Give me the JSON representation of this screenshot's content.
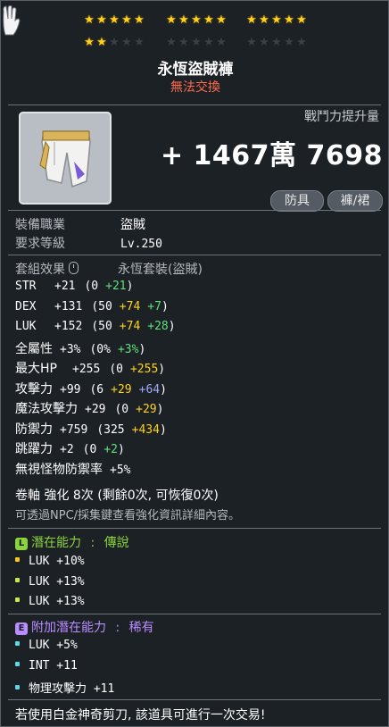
{
  "stars": {
    "groups": [
      {
        "filled": 5,
        "total": 5
      },
      {
        "filled": 5,
        "total": 5
      },
      {
        "filled": 5,
        "total": 5
      },
      {
        "filled": 2,
        "total": 5
      },
      {
        "filled": 0,
        "total": 5
      },
      {
        "filled": 0,
        "total": 5
      }
    ],
    "glyph": "★"
  },
  "item": {
    "name": "永恆盜賊褲",
    "trade_status": "無法交換",
    "combat_power_label": "戰鬥力提升量",
    "combat_power_value": "+ 1467萬 7698",
    "tags": [
      "防具",
      "褲/裙"
    ]
  },
  "requirements": {
    "job_label": "裝備職業",
    "job_value": "盜賊",
    "level_label": "要求等級",
    "level_value": "Lv.250"
  },
  "set": {
    "label": "套組效果",
    "value": "永恆套裝(盜賊)"
  },
  "stats": [
    {
      "name": "STR",
      "total": "+21",
      "base": "(0",
      "parts": [
        {
          "text": "+21",
          "color": "grn"
        }
      ],
      "close": ")"
    },
    {
      "name": "DEX",
      "total": "+131",
      "base": "(50",
      "parts": [
        {
          "text": "+74",
          "color": "yel"
        },
        {
          "text": "+7",
          "color": "grn"
        }
      ],
      "close": ")"
    },
    {
      "name": "LUK",
      "total": "+152",
      "base": "(50",
      "parts": [
        {
          "text": "+74",
          "color": "yel"
        },
        {
          "text": "+28",
          "color": "grn"
        }
      ],
      "close": ")"
    },
    {
      "name": "全屬性",
      "total": "+3%",
      "base": "(0%",
      "parts": [
        {
          "text": "+3%",
          "color": "grn"
        }
      ],
      "close": ")"
    },
    {
      "name": "最大HP",
      "total": "+255",
      "base": "(0",
      "parts": [
        {
          "text": "+255",
          "color": "yel"
        }
      ],
      "close": ")"
    },
    {
      "name": "攻擊力",
      "total": "+99",
      "base": "(6",
      "parts": [
        {
          "text": "+29",
          "color": "yel"
        },
        {
          "text": "+64",
          "color": "blu"
        }
      ],
      "close": ")"
    },
    {
      "name": "魔法攻擊力",
      "total": "+29",
      "base": "(0",
      "parts": [
        {
          "text": "+29",
          "color": "yel"
        }
      ],
      "close": ")"
    },
    {
      "name": "防禦力",
      "total": "+759",
      "base": "(325",
      "parts": [
        {
          "text": "+434",
          "color": "yel"
        }
      ],
      "close": ")"
    },
    {
      "name": "跳躍力",
      "total": "+2",
      "base": "(0",
      "parts": [
        {
          "text": "+2",
          "color": "grn"
        }
      ],
      "close": ")"
    },
    {
      "name": "無視怪物防禦率",
      "total": "+5%",
      "base": "",
      "parts": [],
      "close": ""
    }
  ],
  "upgrade": {
    "scroll_line": "卷軸 強化 8次 (剩餘0次, 可恢復0次)",
    "hint": "可透過NPC/採集鍵查看強化資訊詳細內容。"
  },
  "potential": {
    "badge": "L",
    "label": "潛在能力",
    "separator": ":",
    "grade": "傳說",
    "color": "#8bd33c",
    "lines": [
      "LUK +10%",
      "LUK +13%",
      "LUK +13%"
    ],
    "bullet_colors": [
      "#ffc21a",
      "#c8e84a",
      "#c8e84a"
    ]
  },
  "additional": {
    "badge": "E",
    "label": "附加潛在能力",
    "separator": ":",
    "grade": "稀有",
    "color": "#b98cff",
    "lines": [
      "LUK +5%",
      "INT +11",
      "物理攻擊力 +11"
    ],
    "bullet_colors": [
      "#5fd6e8",
      "#5fd6e8",
      "#5fd6e8"
    ]
  },
  "footer": "若使用白金神奇剪刀, 該道具可進行一次交易!"
}
